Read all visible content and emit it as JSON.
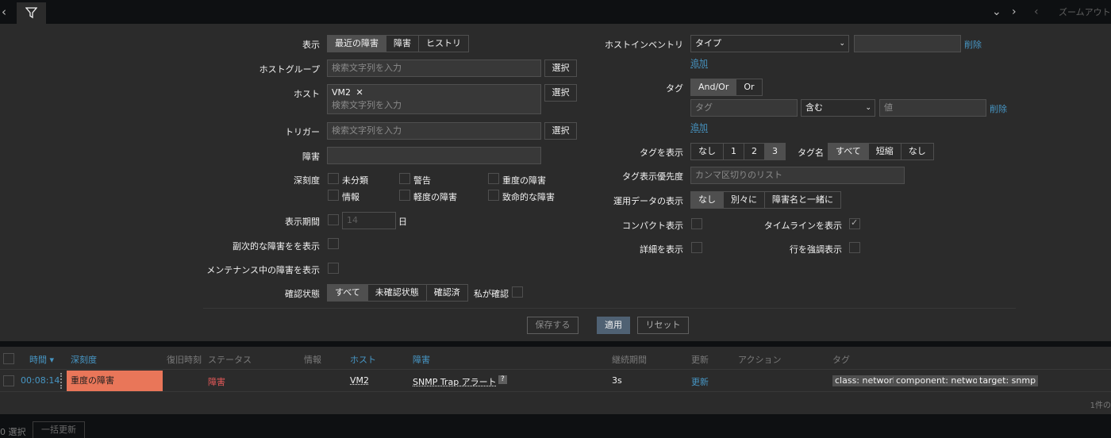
{
  "topbar": {
    "zoom_out": "ズームアウト",
    "icons": [
      "chevron-left-icon",
      "filter-icon",
      "chevron-down-icon",
      "chevron-right-icon",
      "chevron-left-icon"
    ]
  },
  "filter": {
    "show": {
      "label": "表示",
      "options": [
        "最近の障害",
        "障害",
        "ヒストリ"
      ],
      "active": "最近の障害"
    },
    "host_groups": {
      "label": "ホストグループ",
      "placeholder": "検索文字列を入力",
      "select": "選択"
    },
    "hosts": {
      "label": "ホスト",
      "chip": "VM2",
      "placeholder": "検索文字列を入力",
      "select": "選択"
    },
    "triggers": {
      "label": "トリガー",
      "placeholder": "検索文字列を入力",
      "select": "選択"
    },
    "problem": {
      "label": "障害",
      "value": ""
    },
    "severity": {
      "label": "深刻度",
      "options": [
        "未分類",
        "警告",
        "重度の障害",
        "情報",
        "軽度の障害",
        "致命的な障害"
      ]
    },
    "age": {
      "label": "表示期間",
      "value": "14",
      "unit": "日"
    },
    "show_symptoms": {
      "label": "副次的な障害をを表示"
    },
    "show_suppressed": {
      "label": "メンテナンス中の障害を表示"
    },
    "ack_status": {
      "label": "確認状態",
      "options": [
        "すべて",
        "未確認状態",
        "確認済"
      ],
      "active": "すべて",
      "by_me": "私が確認"
    },
    "inventory": {
      "label": "ホストインベントリ",
      "select_value": "タイプ",
      "value": "",
      "remove": "削除",
      "add": "追加"
    },
    "tags": {
      "label": "タグ",
      "options": [
        "And/Or",
        "Or"
      ],
      "active": "And/Or",
      "tag_placeholder": "タグ",
      "operator": "含む",
      "value_placeholder": "値",
      "remove": "削除",
      "add": "追加"
    },
    "show_tags": {
      "label": "タグを表示",
      "options": [
        "なし",
        "1",
        "2",
        "3"
      ],
      "active": "3"
    },
    "tag_name": {
      "label": "タグ名",
      "options": [
        "すべて",
        "短縮",
        "なし"
      ],
      "active": "すべて"
    },
    "tag_priority": {
      "label": "タグ表示優先度",
      "placeholder": "カンマ区切りのリスト"
    },
    "opdata": {
      "label": "運用データの表示",
      "options": [
        "なし",
        "別々に",
        "障害名と一緒に"
      ],
      "active": "なし"
    },
    "compact": {
      "label": "コンパクト表示"
    },
    "timeline": {
      "label": "タイムラインを表示",
      "checked": true
    },
    "details": {
      "label": "詳細を表示"
    },
    "highlight": {
      "label": "行を強調表示"
    },
    "buttons": {
      "save": "保存する",
      "apply": "適用",
      "reset": "リセット"
    }
  },
  "table": {
    "headers": [
      "時間 ▾",
      "深刻度",
      "復旧時刻",
      "ステータス",
      "情報",
      "ホスト",
      "障害",
      "継続期間",
      "更新",
      "アクション",
      "タグ"
    ],
    "rows": [
      {
        "time": "00:08:14",
        "severity": "重度の障害",
        "recovery": "",
        "status": "障害",
        "info": "",
        "host": "VM2",
        "problem": "SNMP Trap アラート",
        "problem_badge": "?",
        "duration": "3s",
        "update": "更新",
        "tags": [
          "class: network",
          "component: network",
          "target: snmp"
        ]
      }
    ],
    "count": "1件の"
  },
  "footer": {
    "selected": "0 選択",
    "mass_update": "一括更新"
  },
  "colors": {
    "bg": "#0e1012",
    "panel": "#2b2b2b",
    "link": "#4796c4",
    "severity_high": "#e97659",
    "problem_red": "#e45959"
  }
}
